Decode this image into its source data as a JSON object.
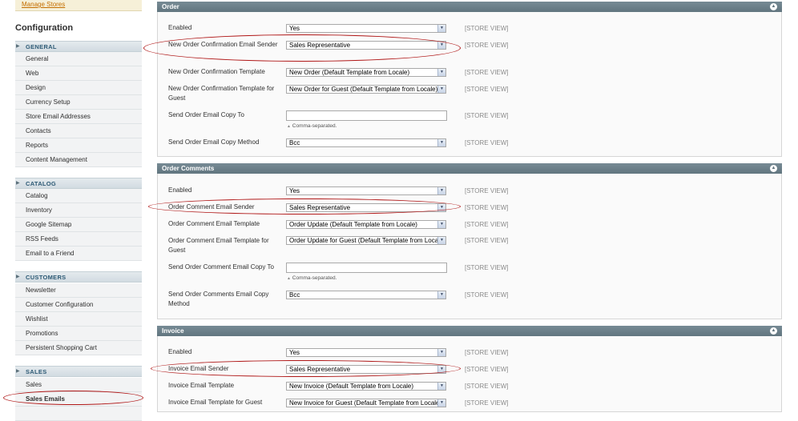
{
  "sidebar": {
    "manage_stores": "Manage Stores",
    "title": "Configuration",
    "groups": [
      {
        "label": "GENERAL",
        "items": [
          "General",
          "Web",
          "Design",
          "Currency Setup",
          "Store Email Addresses",
          "Contacts",
          "Reports",
          "Content Management"
        ]
      },
      {
        "label": "CATALOG",
        "items": [
          "Catalog",
          "Inventory",
          "Google Sitemap",
          "RSS Feeds",
          "Email to a Friend"
        ]
      },
      {
        "label": "CUSTOMERS",
        "items": [
          "Newsletter",
          "Customer Configuration",
          "Wishlist",
          "Promotions",
          "Persistent Shopping Cart"
        ]
      },
      {
        "label": "SALES",
        "items": [
          "Sales",
          "Sales Emails"
        ]
      }
    ],
    "active_item": "Sales Emails"
  },
  "scope_label": "[STORE VIEW]",
  "comma_note": "Comma-separated.",
  "sections": {
    "order": {
      "title": "Order",
      "enabled_label": "Enabled",
      "enabled_value": "Yes",
      "sender_label": "New Order Confirmation Email Sender",
      "sender_value": "Sales Representative",
      "template_label": "New Order Confirmation Template",
      "template_value": "New Order (Default Template from Locale)",
      "guest_template_label": "New Order Confirmation Template for Guest",
      "guest_template_value": "New Order for Guest (Default Template from Locale)",
      "copy_to_label": "Send Order Email Copy To",
      "copy_to_value": "",
      "copy_method_label": "Send Order Email Copy Method",
      "copy_method_value": "Bcc"
    },
    "order_comments": {
      "title": "Order Comments",
      "enabled_label": "Enabled",
      "enabled_value": "Yes",
      "sender_label": "Order Comment Email Sender",
      "sender_value": "Sales Representative",
      "template_label": "Order Comment Email Template",
      "template_value": "Order Update (Default Template from Locale)",
      "guest_template_label": "Order Comment Email Template for Guest",
      "guest_template_value": "Order Update for Guest (Default Template from Locale)",
      "copy_to_label": "Send Order Comment Email Copy To",
      "copy_to_value": "",
      "copy_method_label": "Send Order Comments Email Copy Method",
      "copy_method_value": "Bcc"
    },
    "invoice": {
      "title": "Invoice",
      "enabled_label": "Enabled",
      "enabled_value": "Yes",
      "sender_label": "Invoice Email Sender",
      "sender_value": "Sales Representative",
      "template_label": "Invoice Email Template",
      "template_value": "New Invoice (Default Template from Locale)",
      "guest_template_label": "Invoice Email Template for Guest",
      "guest_template_value": "New Invoice for Guest (Default Template from Locale)"
    }
  },
  "colors": {
    "section_header": "#61757f",
    "sidebar_group_text": "#2d5a75",
    "highlight_oval": "#b01818",
    "link": "#c46e00"
  }
}
